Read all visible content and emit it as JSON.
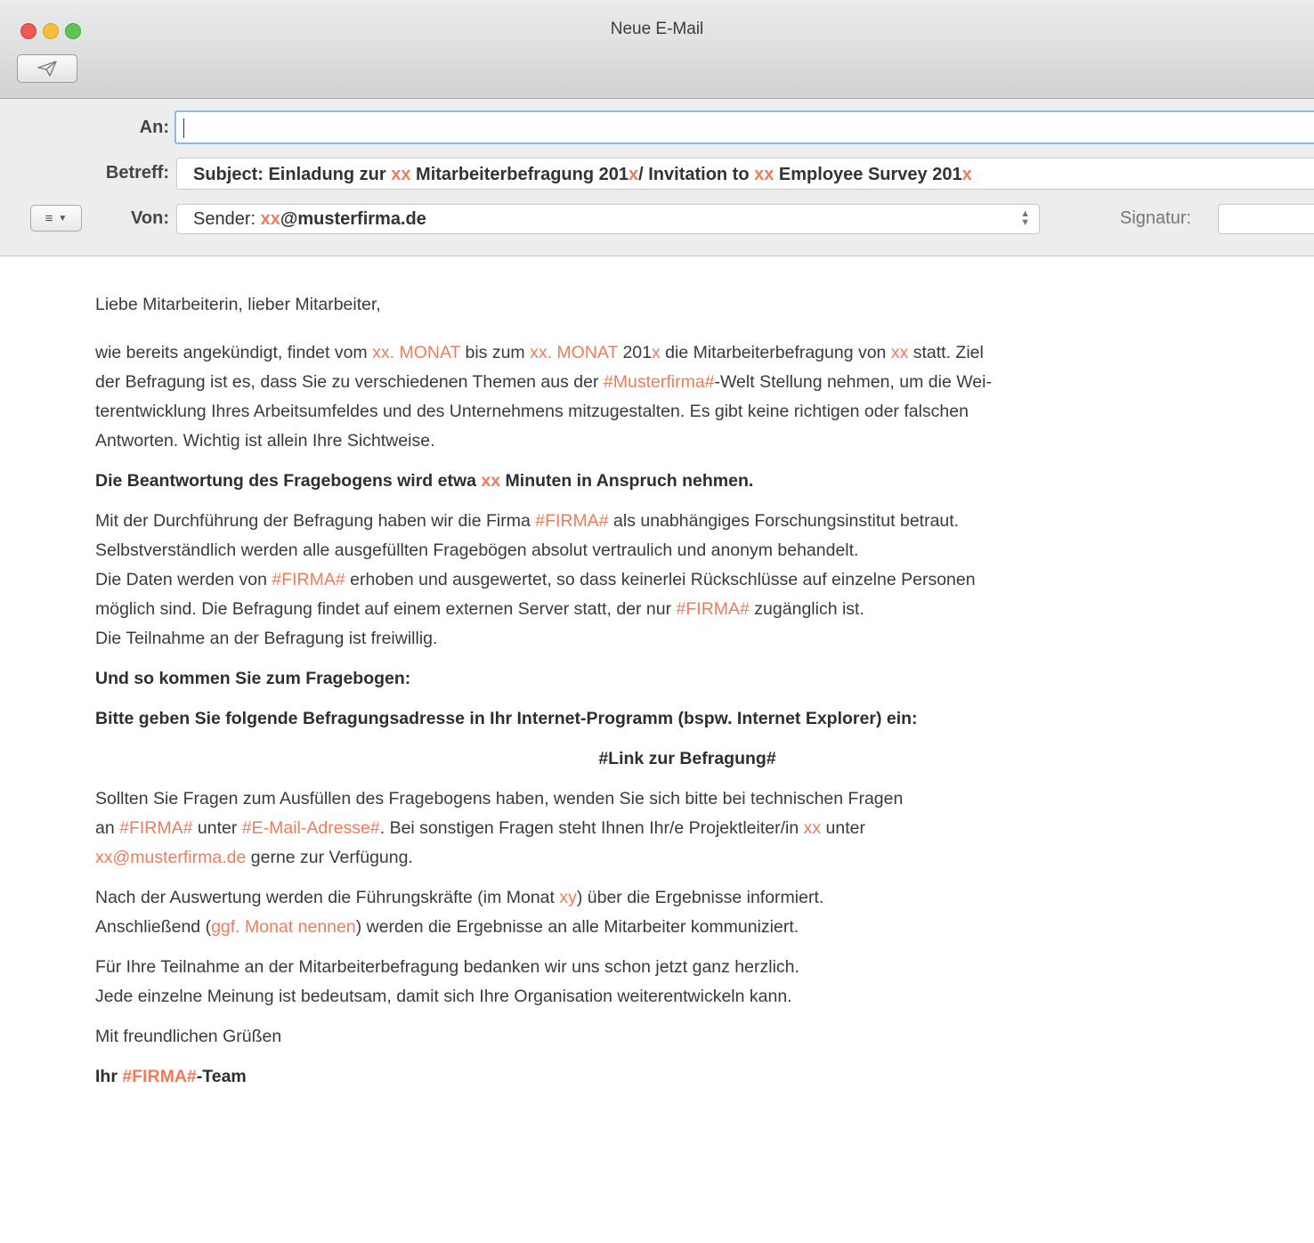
{
  "window": {
    "title": "Neue E-Mail"
  },
  "toolbar": {
    "send_icon": "paper-plane-icon"
  },
  "header": {
    "to_label": "An:",
    "to_value": "",
    "subject_label": "Betreff:",
    "subject_parts": [
      "Subject: Einladung zur ",
      "xx",
      " Mitarbeiterbefragung 201",
      "x",
      "/ Invitation to ",
      "xx",
      " Employee Survey 201",
      "x"
    ],
    "format_icon": "list-icon",
    "from_label": "Von:",
    "from_prefix": "Sender: ",
    "from_highlight": "xx",
    "from_domain": "@musterfirma.de",
    "signature_label": "Signatur:"
  },
  "body": {
    "p1": "Liebe Mitarbeiterin, lieber Mitarbeiter,",
    "p2_lines": [
      [
        "wie bereits angekündigt, findet vom ",
        "xx. MONAT",
        " bis zum ",
        "xx. MONAT",
        " 201",
        "x",
        " die Mitarbeiterbefragung von ",
        "xx",
        " statt. Ziel"
      ],
      [
        "der Befragung ist es, dass Sie zu verschiedenen Themen aus der ",
        "#Musterfirma#",
        "-Welt Stellung nehmen, um die Wei-"
      ],
      [
        "terentwicklung Ihres Arbeitsumfeldes und des Unternehmens mitzugestalten. Es gibt keine richtigen oder falschen"
      ],
      [
        "Antworten. Wichtig ist allein Ihre Sichtweise."
      ]
    ],
    "p3": [
      "Die Beantwortung des Fragebogens wird etwa ",
      "xx",
      " Minuten in Anspruch nehmen."
    ],
    "p4_lines": [
      [
        "Mit der Durchführung der Befragung haben wir die Firma ",
        "#FIRMA#",
        " als unabhängiges Forschungsinstitut betraut."
      ],
      [
        "Selbstverständlich werden alle ausgefüllten Fragebögen absolut vertraulich und anonym behandelt."
      ],
      [
        "Die Daten werden von ",
        "#FIRMA#",
        " erhoben und ausgewertet, so dass keinerlei Rückschlüsse auf einzelne Personen"
      ],
      [
        "möglich sind. Die Befragung findet auf einem externen Server statt, der nur ",
        "#FIRMA#",
        " zugänglich ist."
      ],
      [
        "Die Teilnahme an der Befragung ist freiwillig."
      ]
    ],
    "p5": "Und so kommen Sie zum Fragebogen:",
    "p6": "Bitte geben Sie folgende Befragungsadresse in Ihr Internet-Programm (bspw. Internet Explorer) ein:",
    "link": "#Link zur Befragung#",
    "p7_lines": [
      [
        "Sollten Sie Fragen zum Ausfüllen des Fragebogens haben, wenden Sie sich bitte bei technischen Fragen"
      ],
      [
        "an ",
        "#FIRMA#",
        " unter ",
        "#E-Mail-Adresse#",
        ". Bei sonstigen Fragen steht Ihnen Ihr/e Projektleiter/in ",
        "xx",
        " unter"
      ],
      [
        "",
        "xx@musterfirma.de",
        " gerne zur Verfügung."
      ]
    ],
    "p8_lines": [
      [
        "Nach der Auswertung werden die Führungskräfte (im Monat ",
        "xy",
        ") über die Ergebnisse informiert."
      ],
      [
        "Anschließend (",
        "ggf. Monat nennen",
        ") werden die Ergebnisse an alle Mitarbeiter kommuniziert."
      ]
    ],
    "p9_lines": [
      [
        "Für Ihre Teilnahme an der Mitarbeiterbefragung bedanken wir uns schon jetzt ganz herzlich."
      ],
      [
        "Jede einzelne Meinung ist bedeutsam, damit sich Ihre Organisation weiterentwickeln kann."
      ]
    ],
    "p10": "Mit freundlichen Grüßen",
    "p11": [
      "Ihr ",
      "#FIRMA#",
      "-Team"
    ]
  },
  "colors": {
    "placeholder": "#f07a5a",
    "text": "#3a3a3a"
  }
}
